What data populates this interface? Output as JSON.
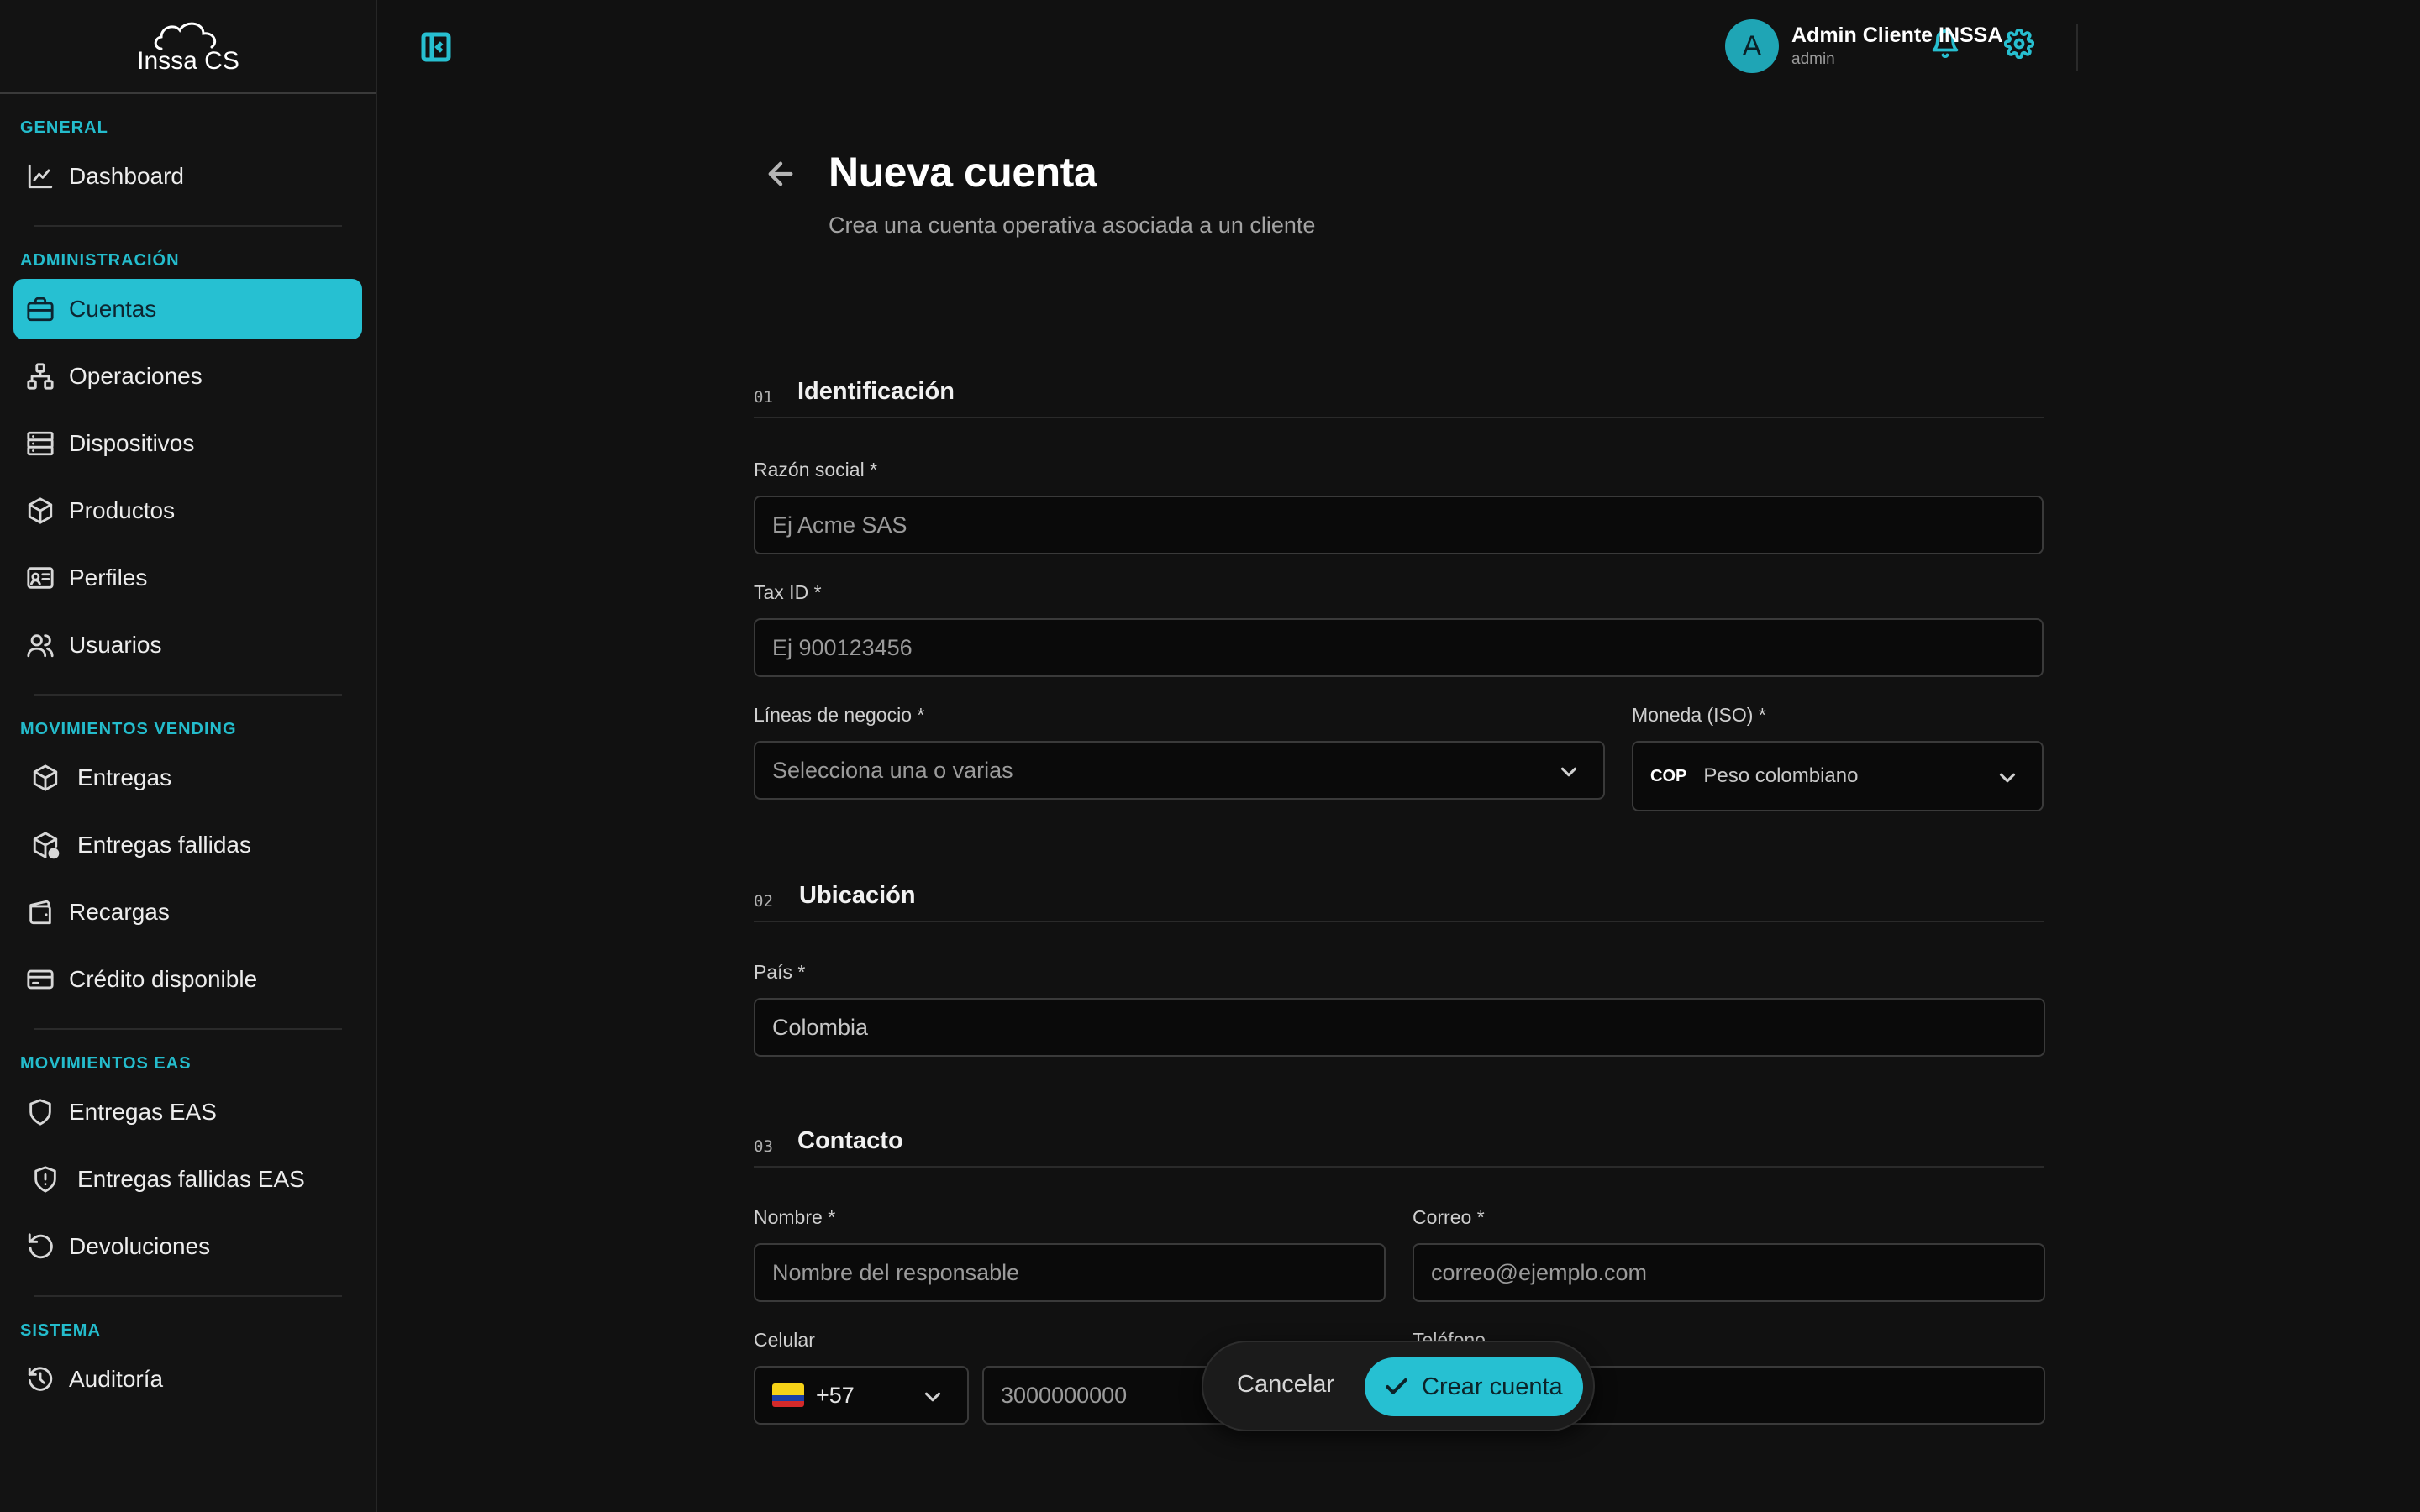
{
  "app": {
    "logo_text": "INSSA CS",
    "accent": "#26c0d2"
  },
  "sidebar": {
    "sections": [
      {
        "title": "GENERAL",
        "items": [
          {
            "label": "Dashboard",
            "icon": "chart-line-icon"
          }
        ]
      },
      {
        "title": "ADMINISTRACIÓN",
        "items": [
          {
            "label": "Cuentas",
            "icon": "briefcase-icon",
            "active": true
          },
          {
            "label": "Operaciones",
            "icon": "network-icon"
          },
          {
            "label": "Dispositivos",
            "icon": "server-icon"
          },
          {
            "label": "Productos",
            "icon": "package-icon"
          },
          {
            "label": "Perfiles",
            "icon": "id-card-icon"
          },
          {
            "label": "Usuarios",
            "icon": "users-icon"
          }
        ]
      },
      {
        "title": "MOVIMIENTOS VENDING",
        "items": [
          {
            "label": "Entregas",
            "icon": "package-icon"
          },
          {
            "label": "Entregas fallidas",
            "icon": "package-alert-icon"
          },
          {
            "label": "Recargas",
            "icon": "wallet-icon"
          },
          {
            "label": "Crédito disponible",
            "icon": "credit-card-icon"
          }
        ]
      },
      {
        "title": "MOVIMIENTOS EAS",
        "items": [
          {
            "label": "Entregas EAS",
            "icon": "shield-icon"
          },
          {
            "label": "Entregas fallidas EAS",
            "icon": "shield-alert-icon"
          },
          {
            "label": "Devoluciones",
            "icon": "rotate-ccw-icon"
          }
        ]
      },
      {
        "title": "SISTEMA",
        "items": [
          {
            "label": "Auditoría",
            "icon": "history-icon"
          }
        ]
      }
    ]
  },
  "header": {
    "user_initial": "A",
    "user_name": "Admin Cliente INSSA",
    "user_role": "admin"
  },
  "page": {
    "title": "Nueva cuenta",
    "subtitle": "Crea una cuenta operativa asociada a un cliente"
  },
  "form": {
    "identificacion": {
      "num": "01",
      "title": "Identificación",
      "razon_label": "Razón social *",
      "razon_placeholder": "Ej Acme SAS",
      "tax_label": "Tax ID *",
      "tax_placeholder": "Ej 900123456",
      "lineas_label": "Líneas de negocio *",
      "lineas_placeholder": "Selecciona una o varias",
      "moneda_label": "Moneda (ISO) *",
      "moneda_code": "COP",
      "moneda_name": "Peso colombiano"
    },
    "ubicacion": {
      "num": "02",
      "title": "Ubicación",
      "pais_label": "País *",
      "pais_value": "Colombia"
    },
    "contacto": {
      "num": "03",
      "title": "Contacto",
      "nombre_label": "Nombre *",
      "nombre_placeholder": "Nombre del responsable",
      "correo_label": "Correo *",
      "correo_placeholder": "correo@ejemplo.com",
      "celular_label": "Celular",
      "dial_code": "+57",
      "celular_placeholder": "3000000000",
      "telefono_label": "Teléfono"
    }
  },
  "actions": {
    "cancel": "Cancelar",
    "create": "Crear cuenta"
  }
}
